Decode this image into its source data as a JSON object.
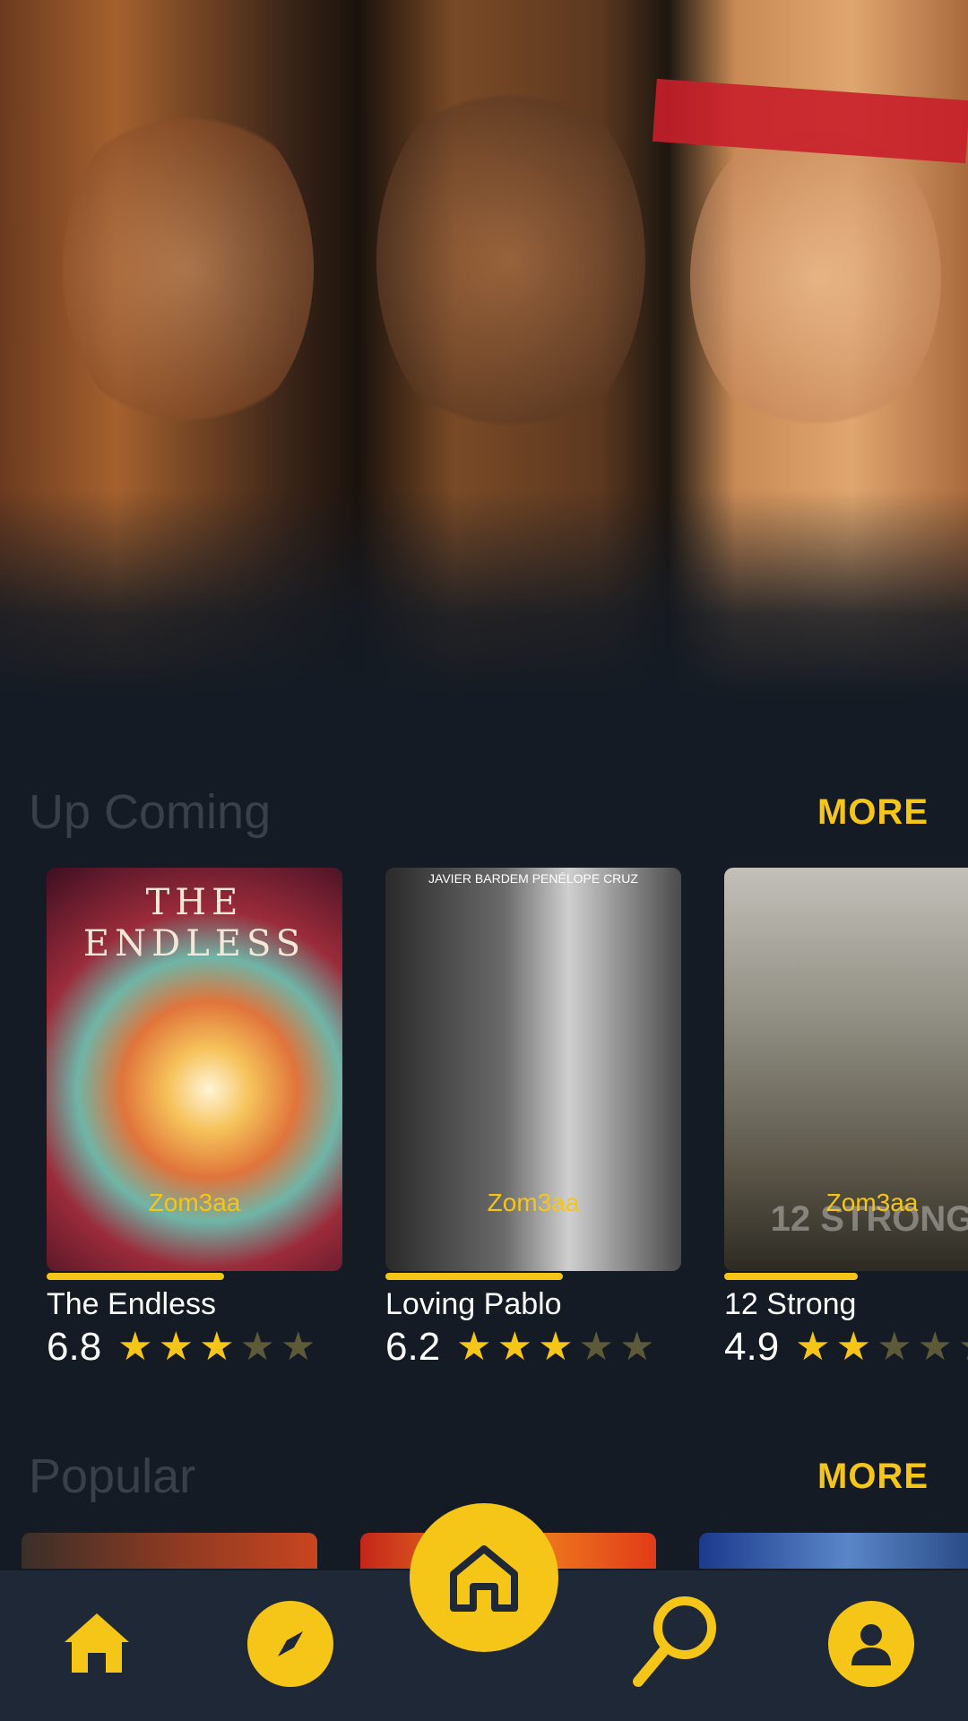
{
  "theme": {
    "accent": "#f5c518",
    "background": "#141b24",
    "nav_background": "#1e2836"
  },
  "upcoming": {
    "title": "Up Coming",
    "more_label": "MORE",
    "items": [
      {
        "title": "The Endless",
        "poster_title": "THE ENDLESS",
        "tag": "Zom3aa",
        "rating": "6.8",
        "stars_filled": 3,
        "stars_total": 5,
        "progress": 0.6
      },
      {
        "title": "Loving Pablo",
        "poster_title": "JAVIER BARDEM   PENÉLOPE CRUZ",
        "tag": "Zom3aa",
        "rating": "6.2",
        "stars_filled": 3,
        "stars_total": 5,
        "progress": 0.6
      },
      {
        "title": "12 Strong",
        "poster_title": "12 STRONG",
        "tag": "Zom3aa",
        "rating": "4.9",
        "stars_filled": 2,
        "stars_total": 5,
        "progress": 0.45
      }
    ]
  },
  "popular": {
    "title": "Popular",
    "more_label": "MORE"
  },
  "nav": {
    "items": [
      "home-icon",
      "compass-icon",
      "search-icon",
      "profile-icon"
    ],
    "center": "home-icon"
  }
}
